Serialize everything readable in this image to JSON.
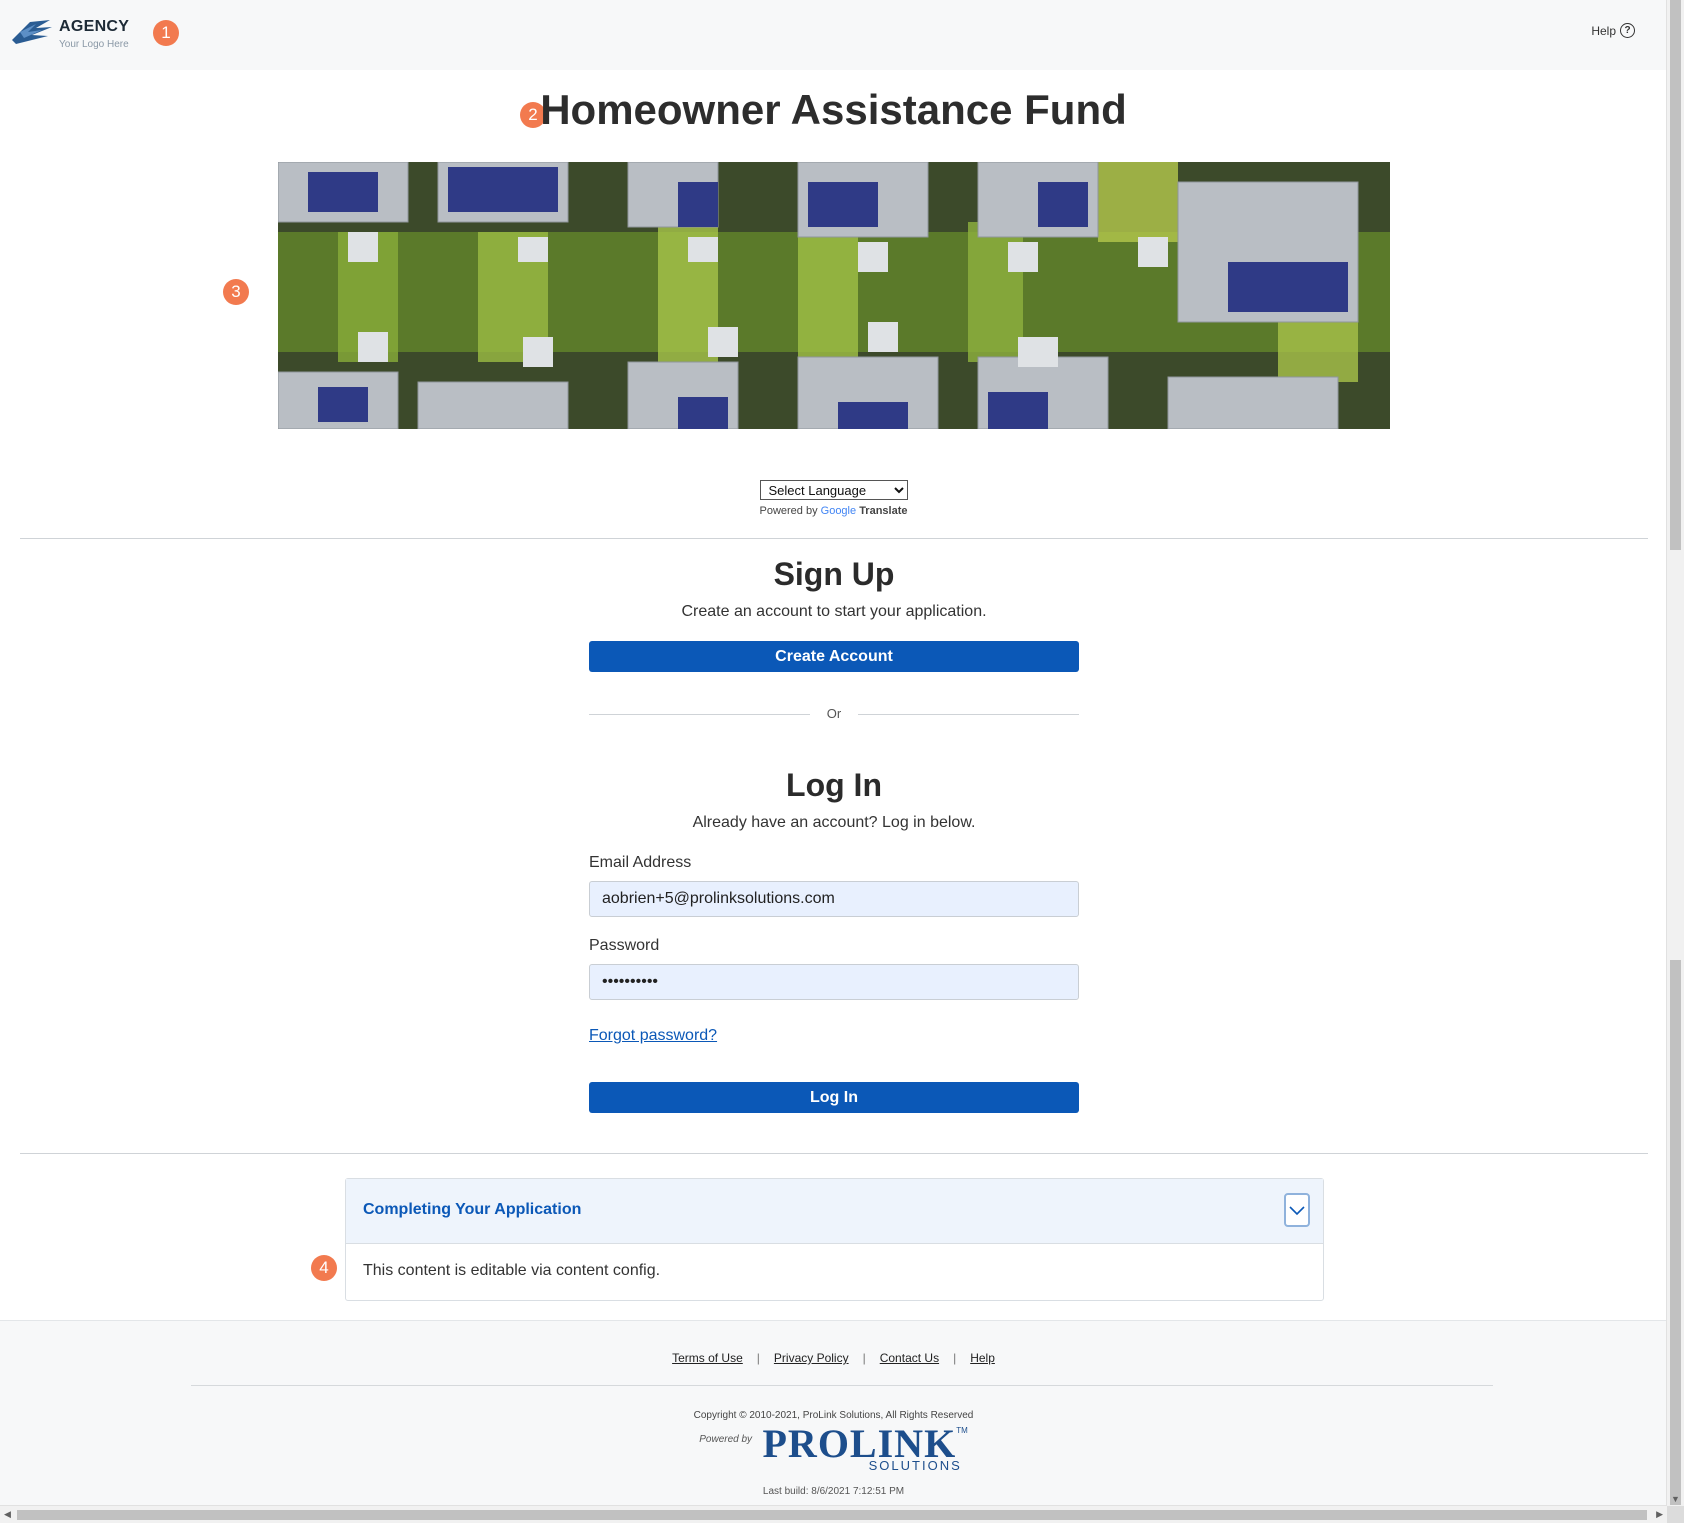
{
  "header": {
    "logo_name": "AGENCY",
    "logo_sub": "Your Logo Here",
    "help_label": "Help",
    "help_icon": "?"
  },
  "markers": [
    "1",
    "2",
    "3",
    "4"
  ],
  "page": {
    "title": "Homeowner Assistance Fund"
  },
  "language": {
    "selected": "Select Language",
    "powered_by": "Powered by",
    "google": "Google",
    "translate": "Translate"
  },
  "signup": {
    "heading": "Sign Up",
    "subtext": "Create an account to start your application.",
    "button": "Create Account"
  },
  "or_label": "Or",
  "login": {
    "heading": "Log In",
    "subtext": "Already have an account? Log in below.",
    "email_label": "Email Address",
    "email_value": "aobrien+5@prolinksolutions.com",
    "password_label": "Password",
    "password_value": "••••••••••",
    "forgot": "Forgot password?",
    "button": "Log In"
  },
  "accordion": {
    "title": "Completing Your Application",
    "body": "This content is editable via content config."
  },
  "footer": {
    "links": [
      "Terms of Use",
      "Privacy Policy",
      "Contact Us",
      "Help"
    ],
    "copyright": "Copyright © 2010-2021, ProLink Solutions, All Rights Reserved",
    "powered_by": "Powered by",
    "brand": "PROLINK",
    "brand_sub": "SOLUTIONS",
    "brand_tm": "TM",
    "last_build": "Last build: 8/6/2021 7:12:51 PM"
  },
  "colors": {
    "primary": "#0b58b7",
    "marker": "#f27a4f",
    "input_bg": "#e8f0fe",
    "accordion_bg": "#eef4fc"
  }
}
